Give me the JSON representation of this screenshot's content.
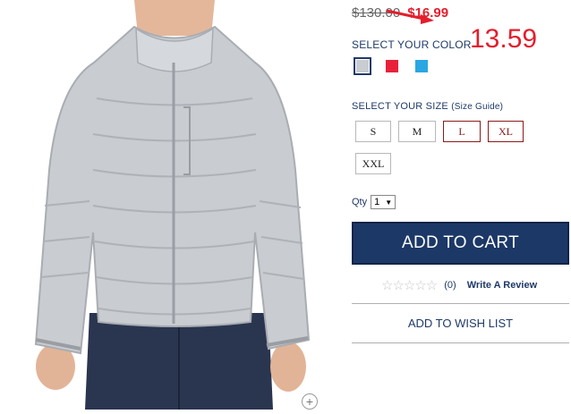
{
  "product": {
    "old_price": "$130.00",
    "new_price": "$16.99"
  },
  "annotation": {
    "text": "13.59",
    "color": "#e31e2d"
  },
  "color_section": {
    "label": "SELECT YOUR COLOR",
    "swatches": [
      {
        "name": "gray",
        "hex": "#c9ccd0",
        "selected": true
      },
      {
        "name": "red",
        "hex": "#e8213a",
        "selected": false
      },
      {
        "name": "blue",
        "hex": "#2aa6e2",
        "selected": false
      }
    ]
  },
  "size_section": {
    "label": "SELECT YOUR SIZE",
    "guide_label": "(Size Guide)",
    "sizes": [
      "S",
      "M",
      "L",
      "XL",
      "XXL"
    ]
  },
  "quantity": {
    "label": "Qty",
    "value": "1"
  },
  "cart": {
    "button_label": "ADD TO CART"
  },
  "reviews": {
    "count_label": "(0)",
    "link_label": "Write A Review"
  },
  "wishlist": {
    "label": "ADD TO WISH LIST"
  },
  "icons": {
    "zoom": "zoom-plus-icon",
    "dropdown": "dropdown-caret-icon",
    "star": "star-outline-icon"
  }
}
